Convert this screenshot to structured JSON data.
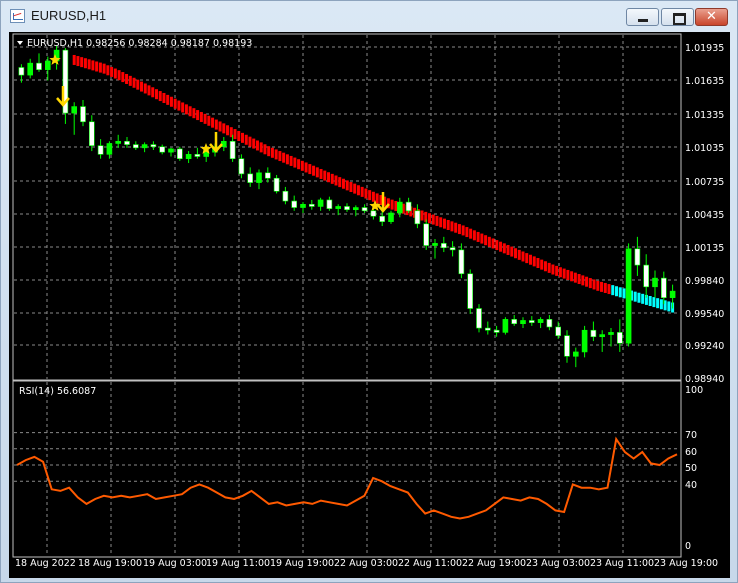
{
  "window": {
    "title": "EURUSD,H1",
    "close_glyph": "✕",
    "icon": "chart-window-icon"
  },
  "main_panel": {
    "header": "EURUSD,H1  0.98256 0.98284 0.98187 0.98193",
    "price_labels": [
      "1.01935",
      "1.01635",
      "1.01335",
      "1.01035",
      "1.00735",
      "1.00435",
      "1.00135",
      "0.99840",
      "0.99540",
      "0.99240",
      "0.98940"
    ],
    "colors": {
      "bull": "#00ff00",
      "bear": "#ffffff",
      "ma_down": "#ff0000",
      "ma_up": "#00ffff",
      "signal": "#ffd700",
      "grid": "#8a8a8a"
    }
  },
  "rsi_panel": {
    "header": "RSI(14) 56.6087",
    "levels": [
      "100",
      "70",
      "60",
      "50",
      "40",
      "0"
    ],
    "color": "#ff5a00"
  },
  "time_axis": {
    "labels": [
      "18 Aug 2022",
      "18 Aug 19:00",
      "19 Aug 03:00",
      "19 Aug 11:00",
      "19 Aug 19:00",
      "22 Aug 03:00",
      "22 Aug 11:00",
      "22 Aug 19:00",
      "23 Aug 03:00",
      "23 Aug 11:00",
      "23 Aug 19:00"
    ]
  },
  "chart_data": {
    "type": "candlestick",
    "symbol": "EURUSD",
    "timeframe": "H1",
    "ylim": [
      0.9886,
      1.0201
    ],
    "candles": [
      [
        1.0172,
        1.0175,
        1.0158,
        1.0165
      ],
      [
        1.0165,
        1.018,
        1.0162,
        1.0176
      ],
      [
        1.0176,
        1.0185,
        1.0168,
        1.017
      ],
      [
        1.017,
        1.0182,
        1.016,
        1.0178
      ],
      [
        1.0178,
        1.0192,
        1.017,
        1.0188
      ],
      [
        1.0188,
        1.019,
        1.012,
        1.013
      ],
      [
        1.013,
        1.014,
        1.011,
        1.0136
      ],
      [
        1.0136,
        1.0142,
        1.0118,
        1.0122
      ],
      [
        1.0122,
        1.0128,
        1.0095,
        1.01
      ],
      [
        1.01,
        1.0106,
        1.0088,
        1.0092
      ],
      [
        1.0092,
        1.0104,
        1.0088,
        1.0102
      ],
      [
        1.0102,
        1.011,
        1.0098,
        1.0104
      ],
      [
        1.0104,
        1.0108,
        1.0098,
        1.0101
      ],
      [
        1.0101,
        1.0104,
        1.0096,
        1.0098
      ],
      [
        1.0098,
        1.0103,
        1.0094,
        1.0101
      ],
      [
        1.0101,
        1.0104,
        1.0096,
        1.0099
      ],
      [
        1.0099,
        1.0101,
        1.0092,
        1.0094
      ],
      [
        1.0094,
        1.0098,
        1.009,
        1.0097
      ],
      [
        1.0097,
        1.0099,
        1.0086,
        1.0088
      ],
      [
        1.0088,
        1.0095,
        1.0084,
        1.0092
      ],
      [
        1.0092,
        1.0098,
        1.0088,
        1.009
      ],
      [
        1.009,
        1.0096,
        1.0085,
        1.0094
      ],
      [
        1.0094,
        1.0102,
        1.009,
        1.0099
      ],
      [
        1.0099,
        1.0108,
        1.0095,
        1.0104
      ],
      [
        1.0104,
        1.011,
        1.0085,
        1.0088
      ],
      [
        1.0088,
        1.0092,
        1.007,
        1.0074
      ],
      [
        1.0074,
        1.008,
        1.0062,
        1.0066
      ],
      [
        1.0066,
        1.0078,
        1.006,
        1.0075
      ],
      [
        1.0075,
        1.008,
        1.0066,
        1.007
      ],
      [
        1.007,
        1.0073,
        1.0056,
        1.0058
      ],
      [
        1.0058,
        1.0062,
        1.0046,
        1.0049
      ],
      [
        1.0049,
        1.0054,
        1.004,
        1.0043
      ],
      [
        1.0043,
        1.0048,
        1.0038,
        1.0046
      ],
      [
        1.0046,
        1.005,
        1.0041,
        1.0044
      ],
      [
        1.0044,
        1.0052,
        1.004,
        1.005
      ],
      [
        1.005,
        1.0053,
        1.004,
        1.0042
      ],
      [
        1.0042,
        1.0046,
        1.0036,
        1.0044
      ],
      [
        1.0044,
        1.0047,
        1.0039,
        1.0041
      ],
      [
        1.0041,
        1.0045,
        1.0035,
        1.0043
      ],
      [
        1.0043,
        1.0046,
        1.0038,
        1.004
      ],
      [
        1.004,
        1.0044,
        1.0032,
        1.0035
      ],
      [
        1.0035,
        1.004,
        1.0026,
        1.003
      ],
      [
        1.003,
        1.004,
        1.0028,
        1.0038
      ],
      [
        1.0038,
        1.0052,
        1.0034,
        1.0048
      ],
      [
        1.0048,
        1.0052,
        1.0038,
        1.004
      ],
      [
        1.004,
        1.0046,
        1.0024,
        1.0028
      ],
      [
        1.0028,
        1.0032,
        1.0004,
        1.0008
      ],
      [
        1.0008,
        1.0014,
        0.9996,
        1.001
      ],
      [
        1.001,
        1.0016,
        1.0002,
        1.0006
      ],
      [
        1.0006,
        1.0012,
        0.9998,
        1.0004
      ],
      [
        1.0004,
        1.001,
        0.9978,
        0.9982
      ],
      [
        0.9982,
        0.9986,
        0.9945,
        0.995
      ],
      [
        0.995,
        0.9954,
        0.9928,
        0.9932
      ],
      [
        0.9932,
        0.9938,
        0.9926,
        0.993
      ],
      [
        0.993,
        0.9934,
        0.9924,
        0.9928
      ],
      [
        0.9928,
        0.9942,
        0.9926,
        0.994
      ],
      [
        0.994,
        0.9944,
        0.9934,
        0.9936
      ],
      [
        0.9936,
        0.9942,
        0.9932,
        0.9939
      ],
      [
        0.9939,
        0.9943,
        0.9934,
        0.9937
      ],
      [
        0.9937,
        0.9942,
        0.9932,
        0.994
      ],
      [
        0.994,
        0.9944,
        0.993,
        0.9933
      ],
      [
        0.9933,
        0.9938,
        0.9922,
        0.9925
      ],
      [
        0.9925,
        0.993,
        0.99,
        0.9906
      ],
      [
        0.9906,
        0.9914,
        0.9896,
        0.991
      ],
      [
        0.991,
        0.9934,
        0.9905,
        0.993
      ],
      [
        0.993,
        0.9938,
        0.992,
        0.9924
      ],
      [
        0.9924,
        0.993,
        0.991,
        0.9926
      ],
      [
        0.9926,
        0.9932,
        0.9915,
        0.9928
      ],
      [
        0.9928,
        0.994,
        0.991,
        0.9918
      ],
      [
        0.9918,
        1.001,
        0.9915,
        1.0005
      ],
      [
        1.0005,
        1.0016,
        0.998,
        0.999
      ],
      [
        0.999,
        1.0,
        0.996,
        0.997
      ],
      [
        0.997,
        0.9985,
        0.996,
        0.9978
      ],
      [
        0.9978,
        0.9984,
        0.9954,
        0.996
      ],
      [
        0.996,
        0.9972,
        0.995,
        0.9966
      ]
    ],
    "rsi_values": [
      50,
      53,
      55,
      52,
      35,
      34,
      36,
      30,
      26,
      29,
      31,
      30,
      31,
      30,
      31,
      32,
      29,
      30,
      31,
      32,
      36,
      38,
      36,
      33,
      30,
      29,
      31,
      34,
      30,
      26,
      27,
      25,
      26,
      27,
      26,
      28,
      27,
      26,
      25,
      28,
      31,
      42,
      40,
      37,
      35,
      33,
      26,
      20,
      22,
      20,
      18,
      17,
      18,
      20,
      22,
      26,
      30,
      29,
      28,
      30,
      29,
      26,
      22,
      21,
      38,
      36,
      36,
      35,
      36,
      66,
      58,
      54,
      58,
      51,
      50,
      54,
      56.6
    ],
    "ma": [
      [
        1.0178,
        1.0174,
        1.017,
        1.0164,
        1.0157,
        1.015,
        1.0143,
        1.0136,
        1.0129,
        1.0122,
        1.0115,
        1.0108,
        1.0101,
        1.0094,
        1.0088,
        1.0082,
        1.0076,
        1.007,
        1.0064,
        1.0058,
        1.0052,
        1.0046,
        1.0041,
        1.0036,
        1.0031,
        1.0026,
        1.0021,
        1.0015,
        1.0009,
        1.0003,
        0.9997,
        0.9991,
        0.9985,
        0.998,
        0.9975,
        0.997,
        0.9966,
        0.9962,
        0.9958,
        0.9954,
        0.995
      ]
    ]
  }
}
